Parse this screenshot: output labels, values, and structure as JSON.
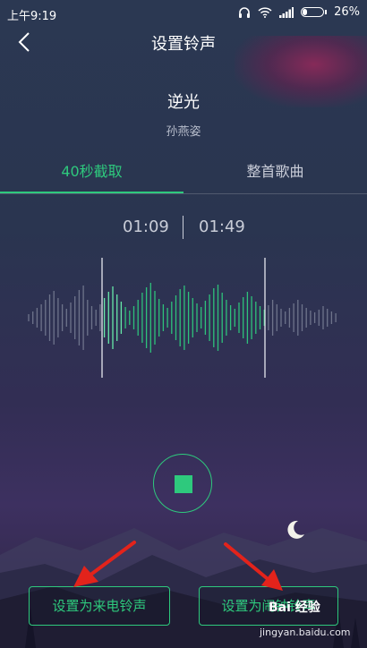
{
  "status_bar": {
    "time": "上午9:19",
    "battery": "26%",
    "battery_level": 0.26
  },
  "header": {
    "title": "设置铃声"
  },
  "song": {
    "title": "逆光",
    "artist": "孙燕姿"
  },
  "tabs": [
    {
      "label": "40秒截取",
      "active": true
    },
    {
      "label": "整首歌曲",
      "active": false
    }
  ],
  "trim": {
    "start": "01:09",
    "end": "01:49"
  },
  "buttons": {
    "set_call_ringtone": "设置为来电铃声",
    "set_alarm_ringtone": "设置为闹钟铃声"
  },
  "watermark": {
    "brand": "Bai 经验",
    "url": "jingyan.baidu.com"
  },
  "colors": {
    "accent": "#2ec97d",
    "arrow": "#e3231b",
    "text_muted": "#b6bccb"
  },
  "icons": {
    "back": "chevron-left-icon",
    "stop": "stop-icon",
    "headphones": "headphones-icon",
    "wifi": "wifi-icon",
    "signal": "signal-icon",
    "battery": "battery-icon",
    "moon": "moon-icon"
  }
}
